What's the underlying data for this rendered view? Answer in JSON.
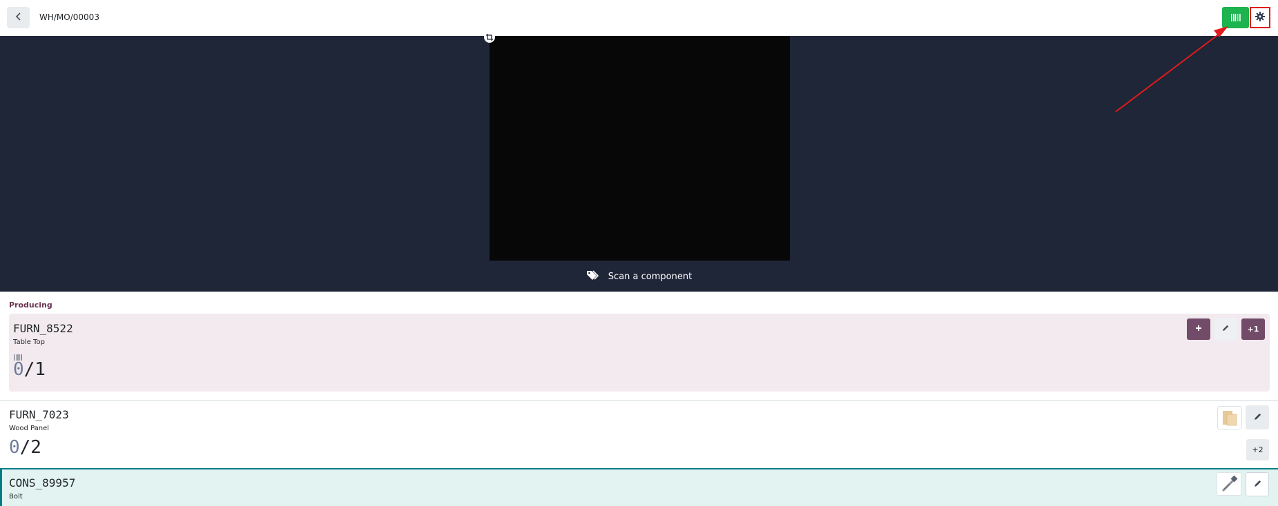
{
  "header": {
    "title": "WH/MO/00003",
    "back_icon": "chevron-left-icon",
    "barcode_icon": "barcode-icon",
    "settings_icon": "gear-icon"
  },
  "scanner": {
    "hint": "Scan a component",
    "hint_icon": "tags-icon"
  },
  "producing": {
    "label": "Producing",
    "product": {
      "code": "FURN_8522",
      "name": "Table Top",
      "qty_done": "0",
      "qty_total": "/1",
      "buttons": {
        "add_icon": "plus-icon",
        "edit_icon": "pencil-icon",
        "increment_label": "+1"
      }
    }
  },
  "components": [
    {
      "code": "FURN_7023",
      "name": "Wood Panel",
      "qty_done": "0",
      "qty_total": "/2",
      "increment_label": "+2",
      "image_icon": "wood-panel-image",
      "edit_icon": "pencil-icon"
    },
    {
      "code": "CONS_89957",
      "name": "Bolt",
      "image_icon": "bolt-image",
      "edit_icon": "pencil-icon"
    }
  ],
  "colors": {
    "primary": "#714b67",
    "scanner_bg": "#1f2638",
    "barcode_green": "#1db34f",
    "annotation_red": "#e01b1b",
    "selected_teal": "#017e84"
  }
}
